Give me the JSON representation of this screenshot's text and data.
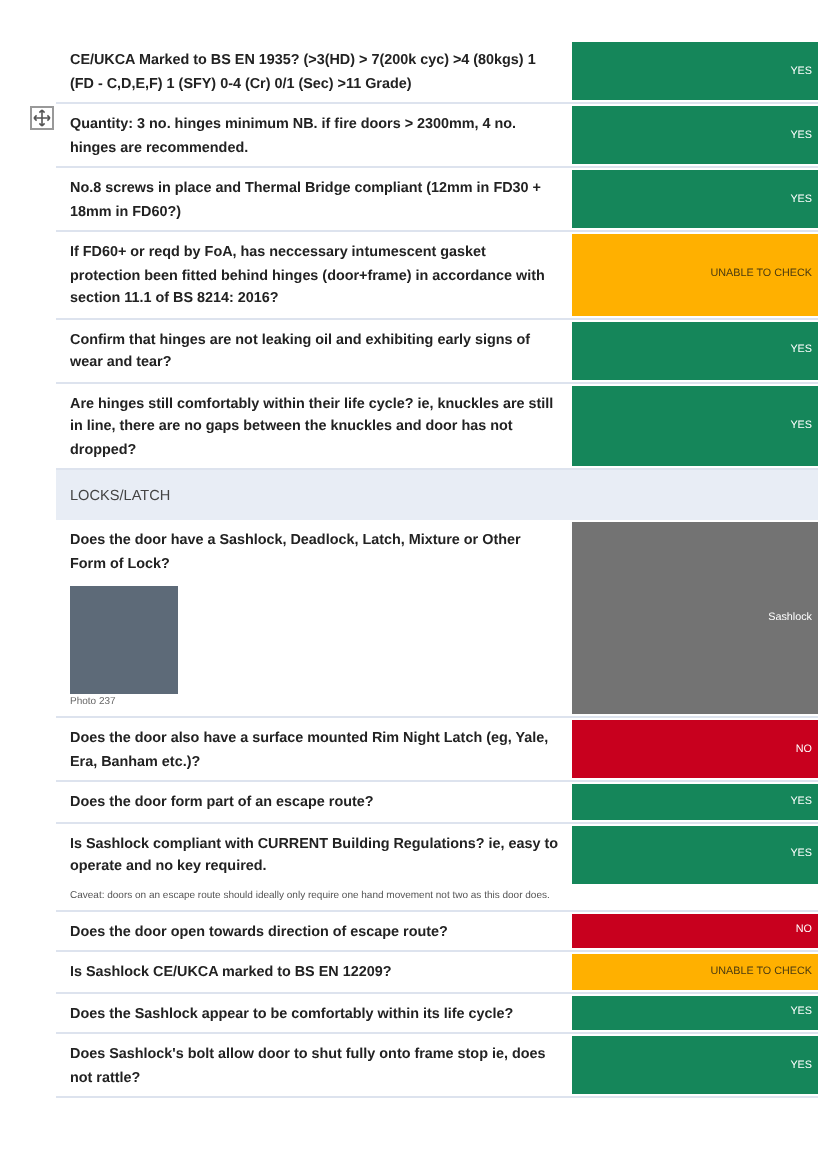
{
  "rows": [
    {
      "kind": "question",
      "question": "CE/UKCA Marked to BS EN 1935? (>3(HD) > 7(200k cyc) >4 (80kgs)  1 (FD - C,D,E,F) 1 (SFY)  0-4 (Cr)  0/1 (Sec)  >11 Grade)",
      "answer": {
        "text": "YES",
        "kind": "yes"
      }
    },
    {
      "kind": "question",
      "question": "Quantity: 3 no. hinges minimum NB. if fire doors > 2300mm, 4 no. hinges are recommended.",
      "answer": {
        "text": "YES",
        "kind": "yes"
      }
    },
    {
      "kind": "question",
      "question": "No.8 screws in place and Thermal Bridge compliant (12mm in FD30 + 18mm in FD60?)",
      "answer": {
        "text": "YES",
        "kind": "yes"
      }
    },
    {
      "kind": "question",
      "question": "If FD60+ or reqd by FoA, has neccessary intumescent gasket protection been fitted behind hinges (door+frame) in accordance with section 11.1 of BS 8214: 2016?",
      "answer": {
        "text": "UNABLE TO CHECK",
        "kind": "unable"
      }
    },
    {
      "kind": "question",
      "question": "Confirm that hinges are not leaking oil and exhibiting early signs of wear and tear?",
      "answer": {
        "text": "YES",
        "kind": "yes"
      }
    },
    {
      "kind": "question",
      "question": "Are hinges still comfortably within their life cycle? ie, knuckles are still in line, there are no gaps between the knuckles and door has not dropped?",
      "answer": {
        "text": "YES",
        "kind": "yes"
      }
    },
    {
      "kind": "section",
      "title": "LOCKS/LATCH"
    },
    {
      "kind": "question",
      "question": "Does the door have a Sashlock, Deadlock, Latch, Mixture or Other Form of Lock?",
      "answer": {
        "text": "Sashlock",
        "kind": "value"
      },
      "photo": {
        "caption": "Photo 237"
      }
    },
    {
      "kind": "question",
      "question": "Does the door also have a surface mounted Rim Night Latch (eg, Yale, Era, Banham etc.)?",
      "answer": {
        "text": "NO",
        "kind": "no"
      }
    },
    {
      "kind": "question",
      "question": "Does the door form part of an escape route?",
      "answer": {
        "text": "YES",
        "kind": "yes"
      }
    },
    {
      "kind": "question",
      "question": "Is Sashlock compliant with CURRENT Building Regulations? ie, easy to operate and no key required.",
      "answer": {
        "text": "YES",
        "kind": "yes"
      },
      "note": "Caveat: doors on an escape route should ideally only require one hand movement not two as this door does."
    },
    {
      "kind": "question",
      "question": "Does the door open towards direction of escape route?",
      "answer": {
        "text": "NO",
        "kind": "no"
      }
    },
    {
      "kind": "question",
      "question": "Is Sashlock CE/UKCA marked to BS EN 12209?",
      "answer": {
        "text": "UNABLE TO CHECK",
        "kind": "unable"
      }
    },
    {
      "kind": "question",
      "question": "Does the Sashlock appear to be comfortably within its life cycle?",
      "answer": {
        "text": "YES",
        "kind": "yes"
      }
    },
    {
      "kind": "question",
      "question": "Does Sashlock's bolt allow door to shut fully onto frame stop ie, does not rattle?",
      "answer": {
        "text": "YES",
        "kind": "yes"
      }
    }
  ]
}
